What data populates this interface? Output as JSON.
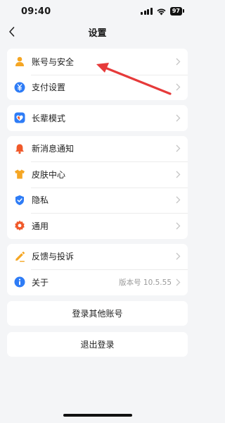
{
  "status": {
    "time": "09:40",
    "battery": "97"
  },
  "nav": {
    "title": "设置"
  },
  "groups": [
    {
      "items": [
        {
          "label": "账号与安全",
          "icon": "person-icon"
        },
        {
          "label": "支付设置",
          "icon": "yen-icon"
        }
      ]
    },
    {
      "items": [
        {
          "label": "长辈模式",
          "icon": "heart-icon"
        }
      ]
    },
    {
      "items": [
        {
          "label": "新消息通知",
          "icon": "bell-icon"
        },
        {
          "label": "皮肤中心",
          "icon": "tshirt-icon"
        },
        {
          "label": "隐私",
          "icon": "shield-check-icon"
        },
        {
          "label": "通用",
          "icon": "gear-icon"
        }
      ]
    },
    {
      "items": [
        {
          "label": "反馈与投诉",
          "icon": "pencil-icon"
        },
        {
          "label": "关于",
          "icon": "info-icon",
          "value": "版本号 10.5.55"
        }
      ]
    }
  ],
  "buttons": {
    "switch_account": "登录其他账号",
    "logout": "退出登录"
  },
  "colors": {
    "orange": "#f5a623",
    "blue": "#2e7cf6",
    "red_orange": "#f0592a",
    "annotation": "#e63a3a",
    "background": "#f4f5f7"
  }
}
